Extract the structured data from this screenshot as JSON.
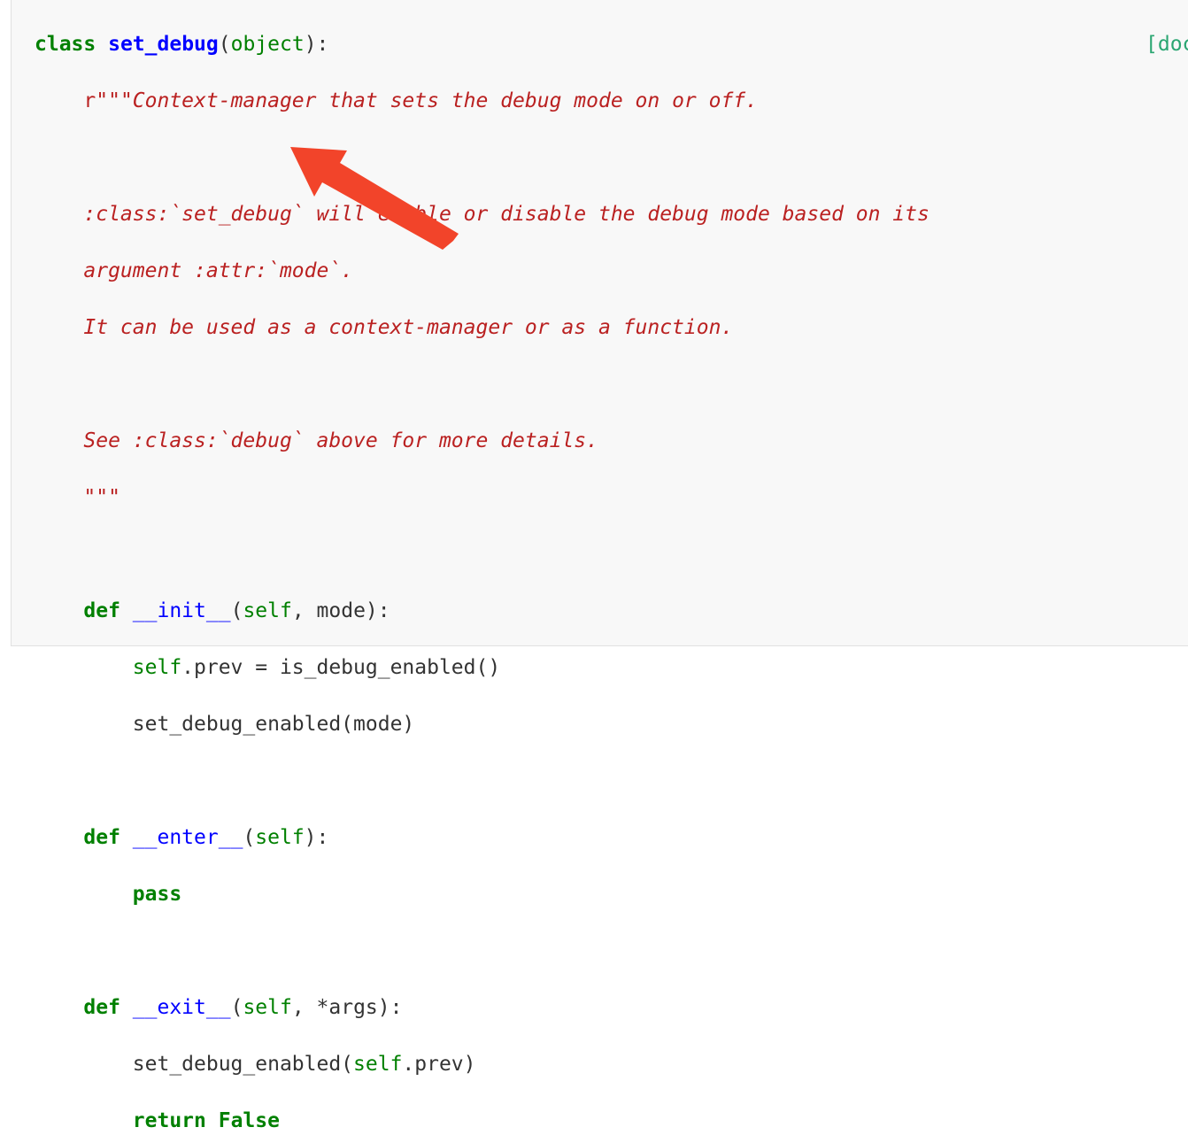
{
  "source_link": "[doc",
  "code": {
    "l1": {
      "kw": "class",
      "name": "set_debug",
      "open": "(",
      "base": "object",
      "close": "):"
    },
    "l2": {
      "prefix": "r",
      "text": "\"\"\"Context-manager that sets the debug mode on or off."
    },
    "l4": {
      "text": ":class:`set_debug` will enable or disable the debug mode based on its"
    },
    "l5": {
      "text": "argument :attr:`mode`."
    },
    "l6": {
      "text": "It can be used as a context-manager or as a function."
    },
    "l8": {
      "text": "See :class:`debug` above for more details."
    },
    "l9": {
      "text": "\"\"\""
    },
    "l11": {
      "kw": "def",
      "name": "__init__",
      "open": "(",
      "self": "self",
      "rest": ", mode):"
    },
    "l12": {
      "self": "self",
      "rest": ".prev = is_debug_enabled()"
    },
    "l13": {
      "text": "set_debug_enabled(mode)"
    },
    "l15": {
      "kw": "def",
      "name": "__enter__",
      "open": "(",
      "self": "self",
      "rest": "):"
    },
    "l16": {
      "kw": "pass"
    },
    "l18": {
      "kw": "def",
      "name": "__exit__",
      "open": "(",
      "self": "self",
      "rest": ", *args):"
    },
    "l19": {
      "pre": "set_debug_enabled(",
      "self": "self",
      "post": ".prev)"
    },
    "l20": {
      "kw": "return",
      "val": "False"
    }
  },
  "colors": {
    "keyword": "#008000",
    "class_name": "#0000ff",
    "docstring": "#ba2121",
    "arrow": "#f2442a",
    "source_link": "#2ba672"
  },
  "icons": {
    "annotation": "arrow-annotation-icon"
  }
}
